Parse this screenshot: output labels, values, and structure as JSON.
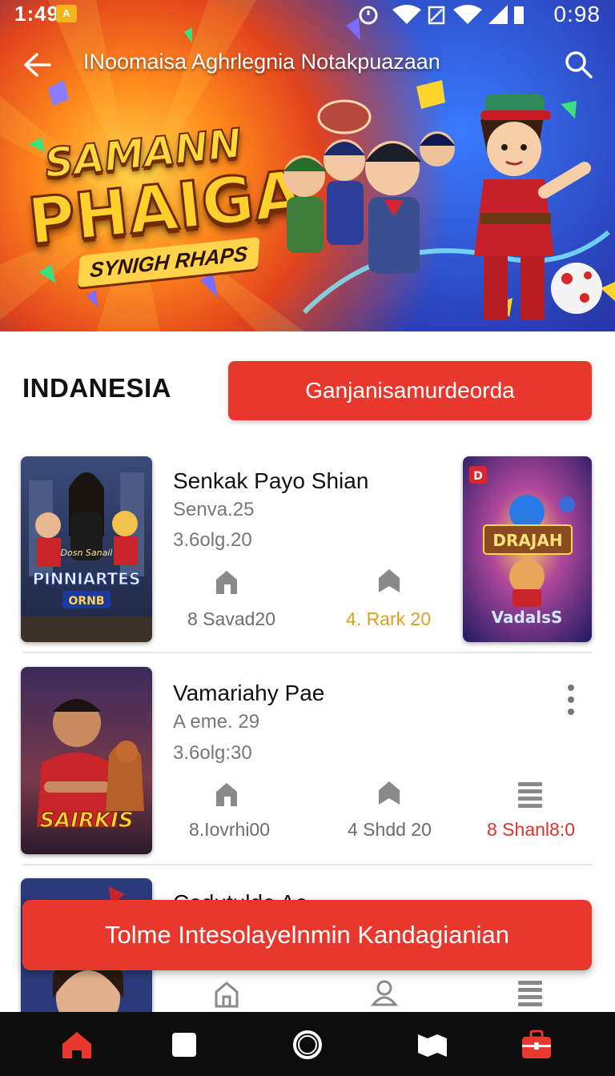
{
  "status_bar": {
    "time": "1:49",
    "badge": "A",
    "clock": "0:98"
  },
  "app_bar": {
    "title": "INoomaisa Aghrlegnia Notakpuazaan",
    "back_icon": "arrow-left-icon",
    "search_icon": "search-icon"
  },
  "hero": {
    "logo_line1": "SAMANN",
    "logo_line2": "PHAIGA",
    "logo_line3": "SYNIGH RHAPS"
  },
  "section": {
    "title": "INDANESIA",
    "button_label": "Ganjanisamurdeorda"
  },
  "items": [
    {
      "title": "Senkak Payo Shian",
      "subtitle": "Senva.25",
      "meta": "3.6olg.20",
      "thumb_caption": "PINNIARTES",
      "thumb_caption_top": "Dosn Sanail",
      "thumb_caption_bottom": "ORNB",
      "stats": [
        {
          "icon": "home-icon",
          "label": "8 Savad20"
        },
        {
          "icon": "bookmark-icon",
          "label": "4. Rark 20"
        }
      ]
    },
    {
      "title": "Vamariahy Pae",
      "subtitle": "A eme. 29",
      "meta": "3.6olg:30",
      "thumb_caption": "SAIRKIS",
      "stats": [
        {
          "icon": "home-icon",
          "label": "8.Iovrhi00"
        },
        {
          "icon": "bookmark-icon",
          "label": "4 Shdd 20"
        },
        {
          "icon": "list-icon",
          "label": "8 Shanl8:0"
        }
      ]
    },
    {
      "title": "Cedutuldo Ae"
    }
  ],
  "side_card": {
    "banner": "DRAJAH",
    "caption": "VadalsS",
    "tag": "D"
  },
  "cta": {
    "label": "Tolme Intesolayelnmin Kandagianian"
  },
  "bottom_nav": [
    "home-icon",
    "square-icon",
    "circle-icon",
    "map-icon",
    "bag-icon"
  ],
  "colors": {
    "accent": "#e8382e",
    "gold": "#d8a21c",
    "nav_bg": "#0d0d0d"
  }
}
